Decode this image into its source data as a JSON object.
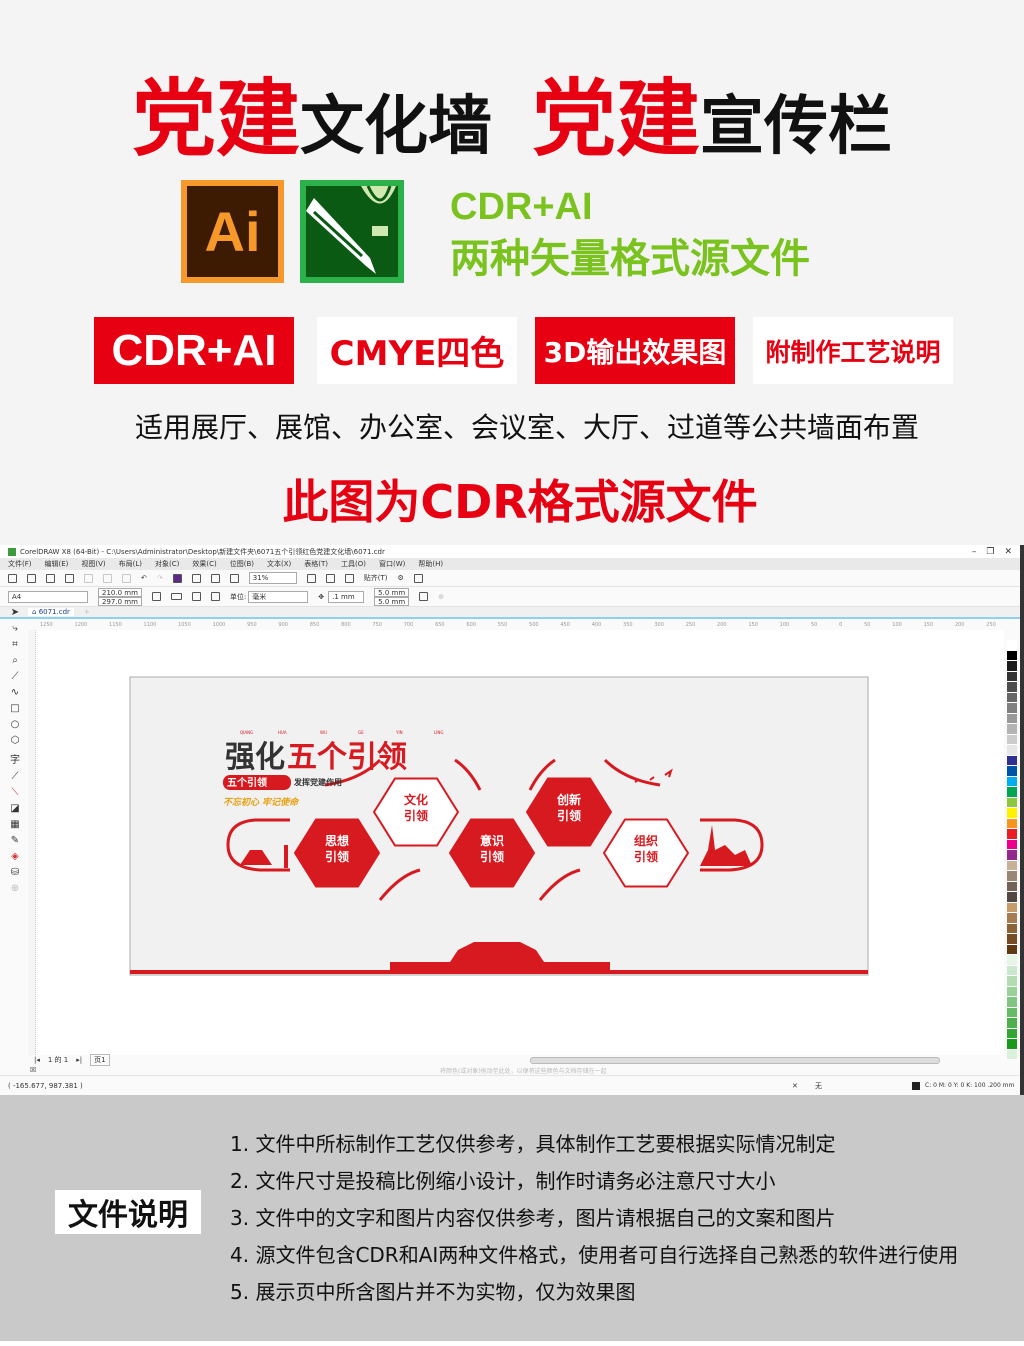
{
  "header": {
    "title_parts": [
      {
        "text": "党建",
        "style": "r"
      },
      {
        "text": "文化墙",
        "style": "k"
      },
      {
        "text": "  ",
        "style": "k"
      },
      {
        "text": "党建",
        "style": "r"
      },
      {
        "text": "宣传栏",
        "style": "k"
      }
    ]
  },
  "logos": {
    "ai": "Ai",
    "cdr": "corel-balloon-pen-icon"
  },
  "formats": {
    "line1": "CDR+AI",
    "line2": "两种矢量格式源文件"
  },
  "badges": [
    {
      "label": "CDR+AI",
      "style": "red"
    },
    {
      "label": "CMYE四色",
      "style": "white"
    },
    {
      "label": "3D输出效果图",
      "style": "red"
    },
    {
      "label": "附制作工艺说明",
      "style": "white"
    }
  ],
  "usage": "适用展厅、展馆、办公室、会议室、大厅、过道等公共墙面布置",
  "cdr_note": "此图为CDR格式源文件",
  "app": {
    "title": "CorelDRAW X8 (64-Bit) - C:\\Users\\Administrator\\Desktop\\新建文件夹\\6071五个引领红色党建文化墙\\6071.cdr",
    "menu": [
      "文件(F)",
      "编辑(E)",
      "视图(V)",
      "布局(L)",
      "对象(C)",
      "效果(C)",
      "位图(B)",
      "文本(X)",
      "表格(T)",
      "工具(O)",
      "窗口(W)",
      "帮助(H)"
    ],
    "zoom": "31%",
    "snap": "贴齐(T)",
    "page_size": "A4",
    "width": "210.0 mm",
    "height": "297.0 mm",
    "unit_label": "单位:",
    "unit": "毫米",
    "nudge": ".1 mm",
    "dup_x": "5.0 mm",
    "dup_y": "5.0 mm",
    "doc_tab": "6071.cdr",
    "ruler": [
      "1250",
      "1200",
      "1150",
      "1100",
      "1050",
      "1000",
      "950",
      "900",
      "850",
      "800",
      "750",
      "700",
      "650",
      "600",
      "550",
      "500",
      "450",
      "400",
      "350",
      "300",
      "250",
      "200",
      "150",
      "100",
      "50",
      "0",
      "50",
      "100",
      "150",
      "200",
      "250"
    ],
    "page_nav": "1 的 1",
    "page_tab": "页1",
    "hint": "将颜色(或对象)拖动至此处，以便将这些颜色与文档存储在一起",
    "coords": "( -165.677, 987.381 )",
    "fill_label": "无",
    "outline_info": "C: 0 M: 0 Y: 0 K: 100  .200 mm",
    "palette": [
      "#ffffff",
      "#000000",
      "#1a1a1a",
      "#333333",
      "#4d4d4d",
      "#666666",
      "#808080",
      "#999999",
      "#b3b3b3",
      "#cccccc",
      "#e6e6e6",
      "#2e3192",
      "#0054a6",
      "#00aeef",
      "#00a651",
      "#8dc63f",
      "#fff200",
      "#f7941d",
      "#ed1c24",
      "#ec008c",
      "#92278f",
      "#c7b299",
      "#998675",
      "#736357",
      "#534741",
      "#c69c6d",
      "#a67c52",
      "#8c6239",
      "#754c24",
      "#603913",
      "#e6f5e6",
      "#cce8cc",
      "#b3dcb3",
      "#99d199",
      "#80c680",
      "#66bb66",
      "#4db04d",
      "#33a533",
      "#1a9a1a",
      "#d9f2d9"
    ]
  },
  "artwork": {
    "title_dark": "强化",
    "title_red": "五个引领",
    "pinyin": [
      "QIANG",
      "HUA",
      "WU",
      "GE",
      "YIN",
      "LING"
    ],
    "subtitle_badge": "五个引领",
    "subtitle": "发挥党建作用",
    "slogan": "不忘初心 牢记使命",
    "hexagons": [
      {
        "l1": "思想",
        "l2": "引领",
        "fill": "red"
      },
      {
        "l1": "文化",
        "l2": "引领",
        "fill": "white"
      },
      {
        "l1": "意识",
        "l2": "引领",
        "fill": "red"
      },
      {
        "l1": "创新",
        "l2": "引领",
        "fill": "red"
      },
      {
        "l1": "组织",
        "l2": "引领",
        "fill": "white"
      }
    ]
  },
  "notes": {
    "title": "文件说明",
    "items": [
      "1. 文件中所标制作工艺仅供参考，具体制作工艺要根据实际情况制定",
      "2. 文件尺寸是投稿比例缩小设计，制作时请务必注意尺寸大小",
      "3. 文件中的文字和图片内容仅供参考，图片请根据自己的文案和图片",
      "4. 源文件包含CDR和AI两种文件格式，使用者可自行选择自己熟悉的软件进行使用",
      "5. 展示页中所含图片并不为实物，仅为效果图"
    ]
  },
  "colors": {
    "red": "#e60012",
    "green": "#7ac21e",
    "ai_orange": "#f7982a",
    "cdr_green": "#2bb04a"
  }
}
